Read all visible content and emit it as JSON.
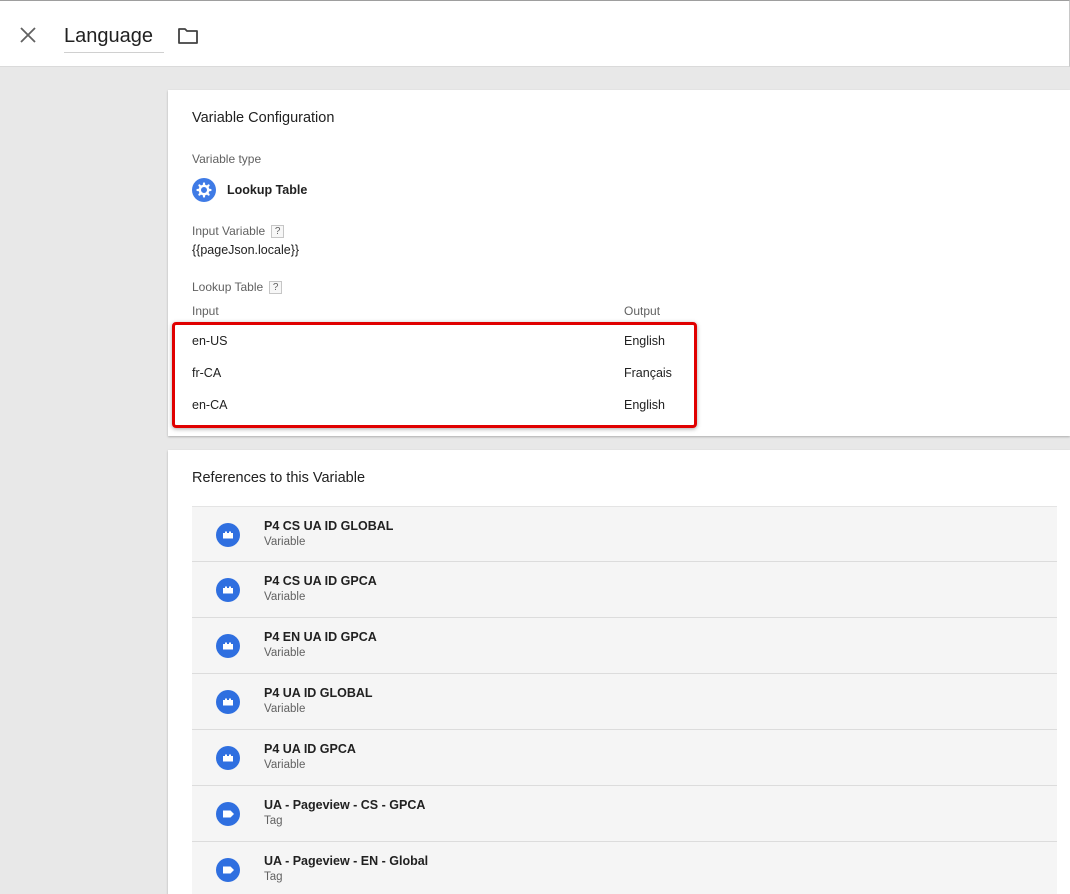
{
  "header": {
    "title": "Language",
    "close_icon": "close-icon",
    "folder_icon": "folder-icon"
  },
  "config": {
    "card_title": "Variable Configuration",
    "variable_type_label": "Variable type",
    "variable_type_name": "Lookup Table",
    "variable_type_icon": "gear-icon",
    "input_variable_label": "Input Variable",
    "input_variable_value": "{{pageJson.locale}}",
    "lookup_table_label": "Lookup Table",
    "help_glyph": "?",
    "col_input": "Input",
    "col_output": "Output",
    "rows": [
      {
        "input": "en-US",
        "output": "English"
      },
      {
        "input": "fr-CA",
        "output": "Français"
      },
      {
        "input": "en-CA",
        "output": "English"
      }
    ],
    "highlight_color": "#e00000"
  },
  "references": {
    "card_title": "References to this Variable",
    "items": [
      {
        "name": "P4 CS UA ID GLOBAL",
        "kind": "Variable",
        "icon": "variable-icon"
      },
      {
        "name": "P4 CS UA ID GPCA",
        "kind": "Variable",
        "icon": "variable-icon"
      },
      {
        "name": "P4 EN UA ID GPCA",
        "kind": "Variable",
        "icon": "variable-icon"
      },
      {
        "name": "P4 UA ID GLOBAL",
        "kind": "Variable",
        "icon": "variable-icon"
      },
      {
        "name": "P4 UA ID GPCA",
        "kind": "Variable",
        "icon": "variable-icon"
      },
      {
        "name": "UA - Pageview - CS - GPCA",
        "kind": "Tag",
        "icon": "tag-icon"
      },
      {
        "name": "UA - Pageview - EN - Global",
        "kind": "Tag",
        "icon": "tag-icon"
      }
    ]
  },
  "colors": {
    "accent": "#3f7be6",
    "background": "#e8e8e8"
  }
}
